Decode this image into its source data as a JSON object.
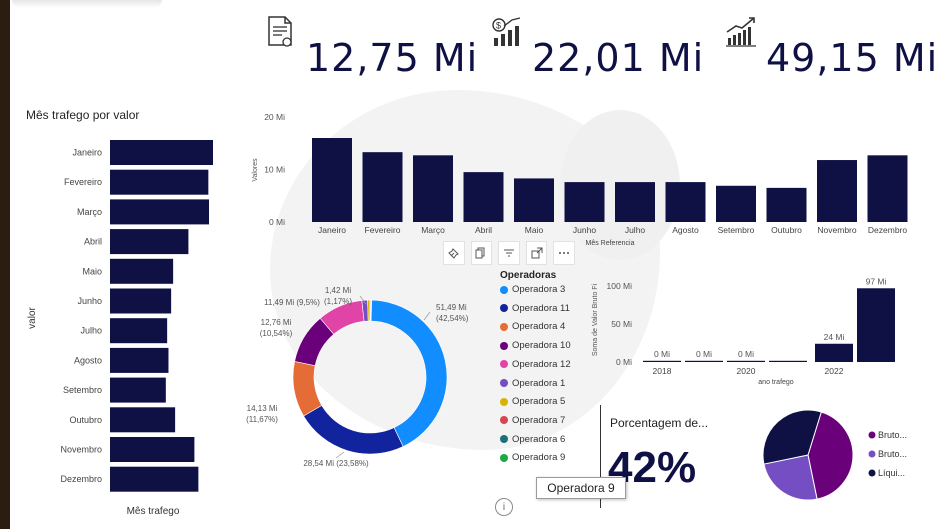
{
  "kpis": [
    {
      "icon": "document-icon",
      "value": "12,75 Mi"
    },
    {
      "icon": "money-growth-icon",
      "value": "22,01 Mi"
    },
    {
      "icon": "growth-chart-icon",
      "value": "49,15 Mi"
    }
  ],
  "colors": {
    "navy": "#0f1145",
    "text": "#252423"
  },
  "chart_data": [
    {
      "type": "bar",
      "orientation": "horizontal",
      "title": "Mês trafego por valor",
      "xlabel": "Mês trafego",
      "ylabel": "valor",
      "categories": [
        "Janeiro",
        "Fevereiro",
        "Março",
        "Abril",
        "Maio",
        "Junho",
        "Julho",
        "Agosto",
        "Setembro",
        "Outubro",
        "Novembro",
        "Dezembro"
      ],
      "values": [
        15.5,
        14.8,
        14.9,
        11.8,
        9.5,
        9.2,
        8.6,
        8.8,
        8.4,
        9.8,
        12.7,
        13.3
      ],
      "color": "#0f1145"
    },
    {
      "type": "bar",
      "xlabel": "Mês Referencia",
      "ylabel": "Valores",
      "categories": [
        "Janeiro",
        "Fevereiro",
        "Março",
        "Abril",
        "Maio",
        "Junho",
        "Julho",
        "Agosto",
        "Setembro",
        "Outubro",
        "Novembro",
        "Dezembro"
      ],
      "values": [
        16,
        13.3,
        12.7,
        9.5,
        8.3,
        7.6,
        7.6,
        7.6,
        6.9,
        6.5,
        11.8,
        12.7
      ],
      "ylim": [
        0,
        20
      ],
      "ticks": [
        "0 Mi",
        "10 Mi",
        "20 Mi"
      ],
      "color": "#0f1145"
    },
    {
      "type": "pie",
      "style": "donut",
      "legend_title": "Operadoras",
      "series": [
        {
          "name": "Operadora 3",
          "value": 51.49,
          "label": "51,49 Mi",
          "pct": "(42,54%)",
          "color": "#118dff"
        },
        {
          "name": "Operadora 11",
          "value": 28.54,
          "label": "28,54 Mi (23,58%)",
          "pct": "",
          "color": "#12239e"
        },
        {
          "name": "Operadora 4",
          "value": 14.13,
          "label": "14,13 Mi",
          "pct": "(11,67%)",
          "color": "#e66c37"
        },
        {
          "name": "Operadora 10",
          "value": 12.76,
          "label": "12,76 Mi",
          "pct": "(10,54%)",
          "color": "#6b007b"
        },
        {
          "name": "Operadora 12",
          "value": 11.49,
          "label": "11,49 Mi (9,5%)",
          "pct": "",
          "color": "#e044a7"
        },
        {
          "name": "Operadora 1",
          "value": 1.42,
          "label": "1,42 Mi",
          "pct": "(1,17%)",
          "color": "#744ec2"
        },
        {
          "name": "Operadora 5",
          "value": 0.6,
          "label": "",
          "pct": "",
          "color": "#d9b300"
        },
        {
          "name": "Operadora 7",
          "value": 0.2,
          "label": "",
          "pct": "",
          "color": "#d64550"
        },
        {
          "name": "Operadora 6",
          "value": 0.1,
          "label": "",
          "pct": "",
          "color": "#197278"
        },
        {
          "name": "Operadora 9",
          "value": 0.1,
          "label": "",
          "pct": "",
          "color": "#1aab40"
        }
      ]
    },
    {
      "type": "bar",
      "xlabel": "ano trafego",
      "ylabel": "Soma de Valor Bruto Fi",
      "categories": [
        "2018",
        "",
        "2020",
        "",
        "2022",
        ""
      ],
      "values": [
        0,
        0,
        0,
        0,
        24,
        97
      ],
      "data_labels": [
        "0 Mi",
        "0 Mi",
        "0 Mi",
        "",
        "24 Mi",
        "97 Mi"
      ],
      "ylim": [
        0,
        100
      ],
      "ticks": [
        "0 Mi",
        "50 Mi",
        "100 Mi"
      ],
      "color": "#0f1145"
    },
    {
      "type": "pie",
      "series": [
        {
          "name": "Bruto...",
          "value": 42,
          "color": "#6b007b"
        },
        {
          "name": "Bruto...",
          "value": 25,
          "color": "#744ec2"
        },
        {
          "name": "Líqui...",
          "value": 33,
          "color": "#0f1145"
        }
      ]
    }
  ],
  "toolbar": [
    "pin-icon",
    "copy-icon",
    "filter-icon",
    "focus-icon",
    "more-icon"
  ],
  "card": {
    "label": "Porcentagem de...",
    "value": "42%"
  },
  "tooltip": {
    "text": "Operadora 9"
  },
  "info": "i"
}
